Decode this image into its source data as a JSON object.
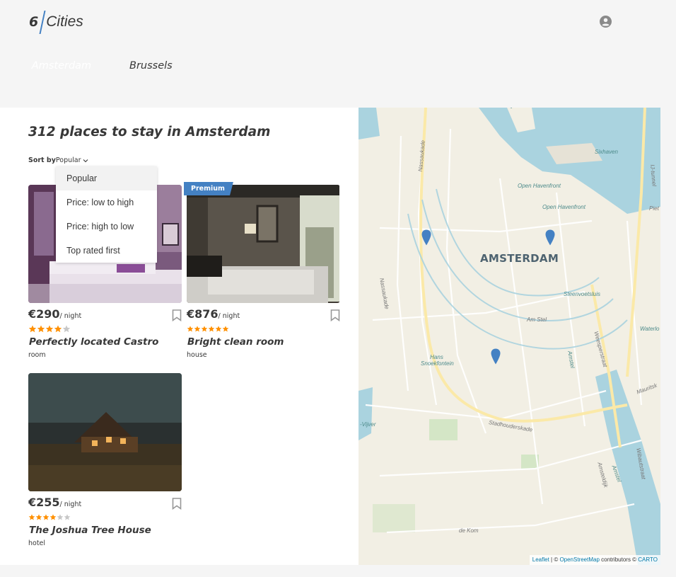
{
  "header": {
    "logo_number": "6",
    "logo_text": "Cities"
  },
  "tabs": [
    {
      "label": "Amsterdam",
      "active": true
    },
    {
      "label": "Brussels",
      "active": false
    }
  ],
  "places": {
    "title": "312 places to stay in Amsterdam",
    "sort_label": "Sort by",
    "sort_value": "Popular",
    "sort_options": [
      "Popular",
      "Price: low to high",
      "Price: high to low",
      "Top rated first"
    ]
  },
  "offers": [
    {
      "price": "€290",
      "per_night": "/ night",
      "rating": 4,
      "name": "Perfectly located Castro",
      "type": "room",
      "premium": false
    },
    {
      "price": "€876",
      "per_night": "/ night",
      "rating": 5,
      "name": "Bright clean room",
      "type": "house",
      "premium": true,
      "premium_label": "Premium"
    },
    {
      "price": "€255",
      "per_night": "/ night",
      "rating": 3,
      "name": "The Joshua Tree House",
      "type": "hotel",
      "premium": false
    }
  ],
  "map": {
    "city_label": "AMSTERDAM",
    "labels": {
      "nassaukade_1": "Nassaukade",
      "nassaukade_2": "Nassaukade",
      "open_havenfront_1": "Open Havenfront",
      "open_havenfront_2": "Open Havenfront",
      "ij_tunnel": "IJ-tunnel",
      "sixhaven": "Sixhaven",
      "steenvoetsluis": "Steenvoetsluis",
      "weesperstraat": "Weesperstraat",
      "hans_snoekfontein": "Hans Snoekfontein",
      "stadhouderskade": "Stadhouderskade",
      "amstel_1": "Amstel",
      "amstel_2": "Amstel",
      "amsteldijk": "Amsteldijk",
      "wibautstraat": "Wibautstraat",
      "de_kom": "de Kom",
      "vijver": "-Vijver",
      "watering": "Waterlo",
      "all_stel": "Am Stel",
      "mauritsk": "Mauritsk",
      "piet": "Piet"
    },
    "attribution_leaflet": "Leaflet",
    "attribution_sep": " | © ",
    "attribution_osm": "OpenStreetMap",
    "attribution_contrib": " contributors © ",
    "attribution_carto": "CARTO"
  },
  "colors": {
    "accent": "#4481c3",
    "star": "#ff9000",
    "star_empty": "#c7c7c7",
    "water": "#aad3df",
    "park": "#d4e6c6"
  }
}
